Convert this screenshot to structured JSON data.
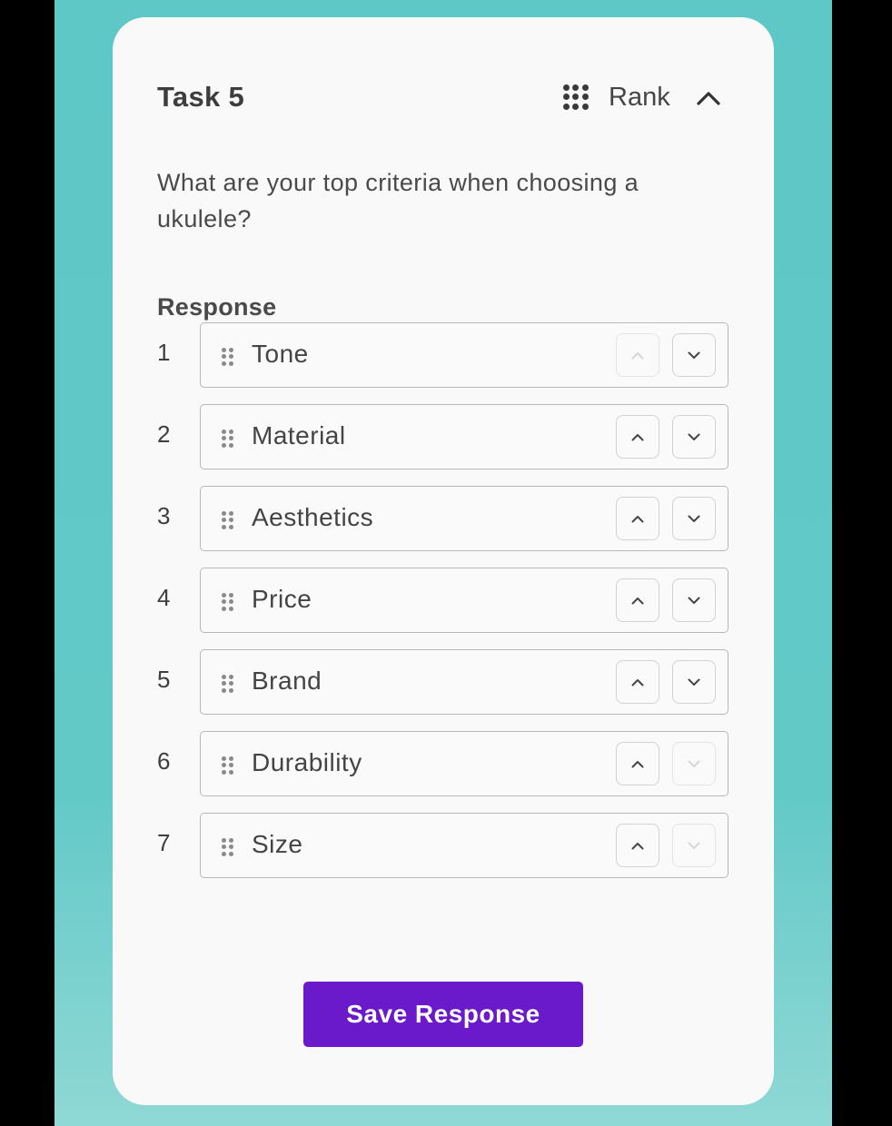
{
  "task": {
    "title": "Task 5",
    "type_icon": "grid-dots-icon",
    "type_label": "Rank",
    "collapse_icon": "chevron-up-icon",
    "question": "What are your top criteria when choosing a ukulele?"
  },
  "response": {
    "label": "Response",
    "items": [
      {
        "rank": "1",
        "label": "Tone",
        "up_disabled": true,
        "down_disabled": false
      },
      {
        "rank": "2",
        "label": "Material",
        "up_disabled": false,
        "down_disabled": false
      },
      {
        "rank": "3",
        "label": "Aesthetics",
        "up_disabled": false,
        "down_disabled": false
      },
      {
        "rank": "4",
        "label": "Price",
        "up_disabled": false,
        "down_disabled": false
      },
      {
        "rank": "5",
        "label": "Brand",
        "up_disabled": false,
        "down_disabled": false
      },
      {
        "rank": "6",
        "label": "Durability",
        "up_disabled": false,
        "down_disabled": true
      },
      {
        "rank": "7",
        "label": "Size",
        "up_disabled": false,
        "down_disabled": true
      }
    ]
  },
  "save_button": {
    "label": "Save Response"
  },
  "colors": {
    "background_teal": "#5ec8c6",
    "card": "#f9f9f9",
    "primary_button": "#6a1acb",
    "border": "#b8b8b8"
  }
}
